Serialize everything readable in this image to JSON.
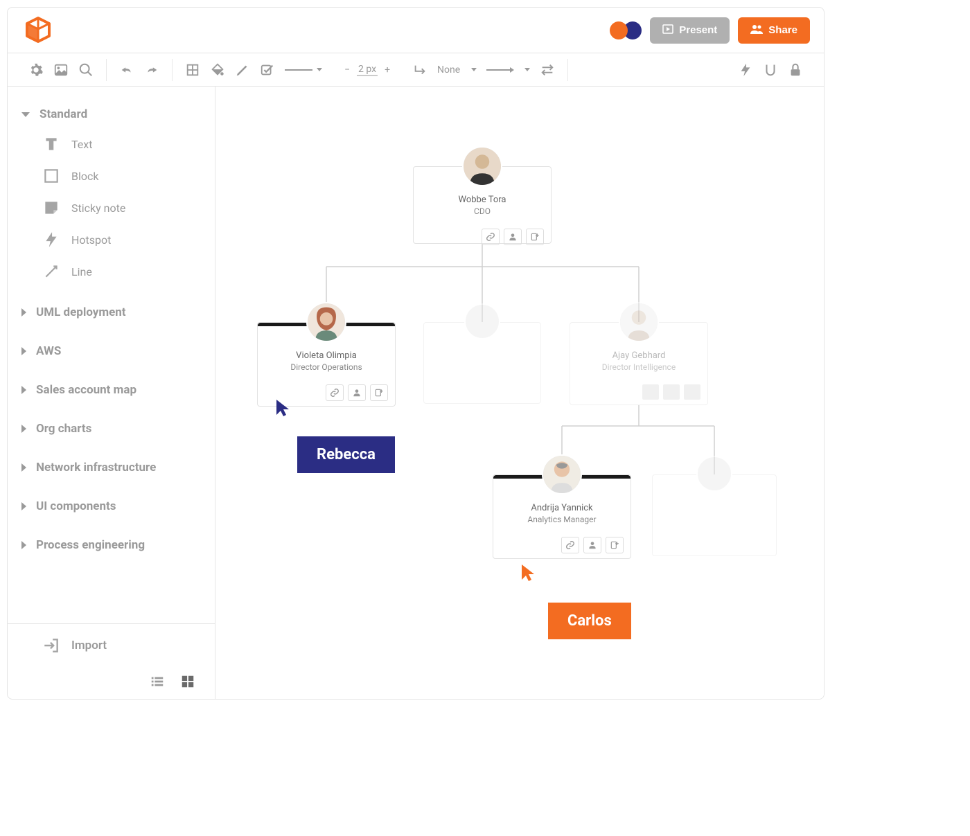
{
  "header": {
    "present_label": "Present",
    "share_label": "Share"
  },
  "toolbar": {
    "stroke_width": "2 px",
    "line_end": "None"
  },
  "sidebar": {
    "sections": [
      {
        "label": "Standard",
        "expanded": true
      },
      {
        "label": "UML deployment",
        "expanded": false
      },
      {
        "label": "AWS",
        "expanded": false
      },
      {
        "label": "Sales account map",
        "expanded": false
      },
      {
        "label": "Org charts",
        "expanded": false
      },
      {
        "label": "Network infrastructure",
        "expanded": false
      },
      {
        "label": "UI components",
        "expanded": false
      },
      {
        "label": "Process engineering",
        "expanded": false
      }
    ],
    "standard_items": [
      {
        "label": "Text"
      },
      {
        "label": "Block"
      },
      {
        "label": "Sticky note"
      },
      {
        "label": "Hotspot"
      },
      {
        "label": "Line"
      }
    ],
    "import_label": "Import"
  },
  "org_chart": {
    "root": {
      "name": "Wobbe Tora",
      "title": "CDO"
    },
    "left": {
      "name": "Violeta Olimpia",
      "title": "Director Operations"
    },
    "right": {
      "name": "Ajay Gebhard",
      "title": "Director Intelligence"
    },
    "child": {
      "name": "Andrija Yannick",
      "title": "Analytics Manager"
    }
  },
  "cursors": {
    "rebecca": "Rebecca",
    "carlos": "Carlos"
  },
  "colors": {
    "accent_orange": "#F36C21",
    "accent_navy": "#2B2D84"
  }
}
